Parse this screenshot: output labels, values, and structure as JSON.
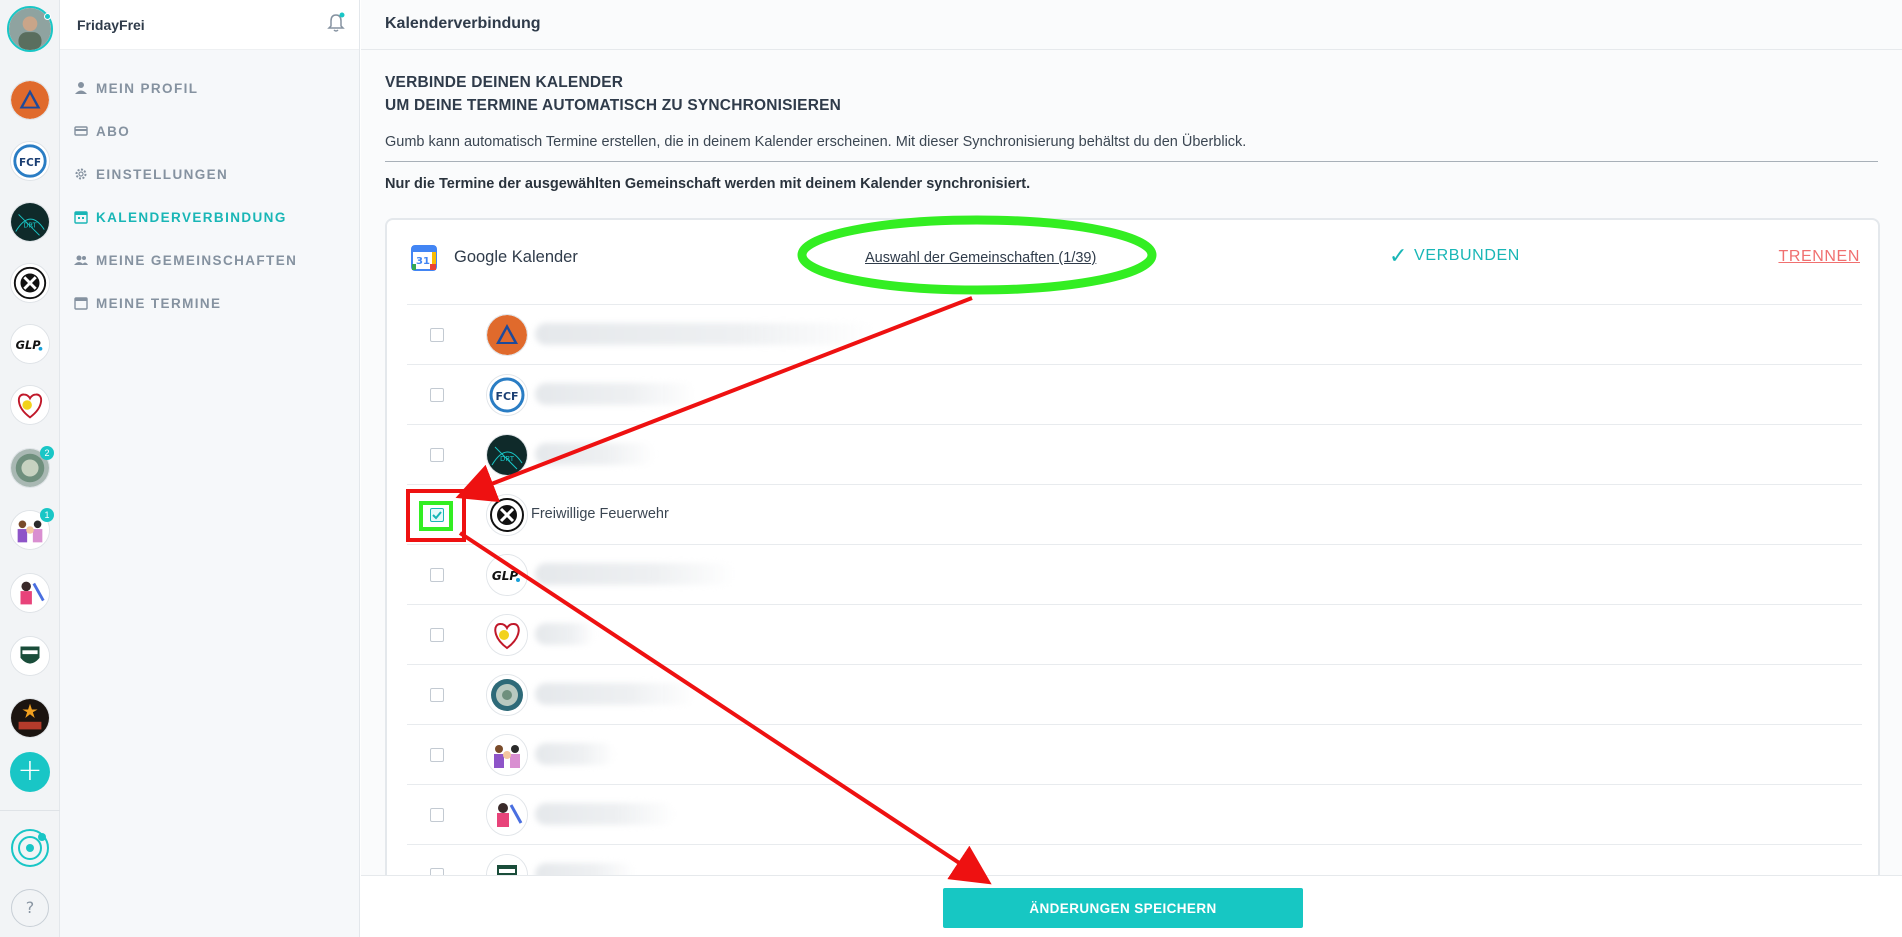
{
  "sidebar": {
    "username": "FridayFrei",
    "items": [
      {
        "label": "MEIN PROFIL",
        "icon": "user-icon"
      },
      {
        "label": "ABO",
        "icon": "card-icon"
      },
      {
        "label": "EINSTELLUNGEN",
        "icon": "gear-icon"
      },
      {
        "label": "KALENDERVERBINDUNG",
        "icon": "calendar-icon",
        "active": true
      },
      {
        "label": "MEINE GEMEINSCHAFTEN",
        "icon": "users-icon"
      },
      {
        "label": "MEINE TERMINE",
        "icon": "calendar-icon"
      }
    ]
  },
  "rail": {
    "badges": [
      "2",
      "1"
    ],
    "add_label": "+",
    "help_label": "?"
  },
  "main": {
    "title": "Kalenderverbindung",
    "headline_1": "VERBINDE DEINEN KALENDER",
    "headline_2": "UM DEINE TERMINE AUTOMATISCH ZU SYNCHRONISIEREN",
    "description": "Gumb kann automatisch Termine erstellen, die in deinem Kalender erscheinen. Mit dieser Synchronisierung behältst du den Überblick.",
    "note": "Nur die Termine der ausgewählten Gemeinschaft werden mit deinem Kalender synchronisiert."
  },
  "calendar": {
    "provider": "Google Kalender",
    "icon_text": "31",
    "selection_link": "Auswahl der Gemeinschaften (1/39)",
    "status": "VERBUNDEN",
    "disconnect": "TRENNEN"
  },
  "communities": [
    {
      "name": "",
      "checked": false
    },
    {
      "name": "",
      "checked": false
    },
    {
      "name": "",
      "checked": false
    },
    {
      "name": "Freiwillige Feuerwehr",
      "checked": true
    },
    {
      "name": "",
      "checked": false
    },
    {
      "name": "",
      "checked": false
    },
    {
      "name": "",
      "checked": false
    },
    {
      "name": "",
      "checked": false
    },
    {
      "name": "",
      "checked": false
    },
    {
      "name": "",
      "checked": false
    }
  ],
  "footer": {
    "save_label": "ÄNDERUNGEN SPEICHERN"
  },
  "colors": {
    "accent": "#19c6c6",
    "danger": "#f07070",
    "annotation_green": "#33ee22",
    "annotation_red": "#ee1111"
  }
}
